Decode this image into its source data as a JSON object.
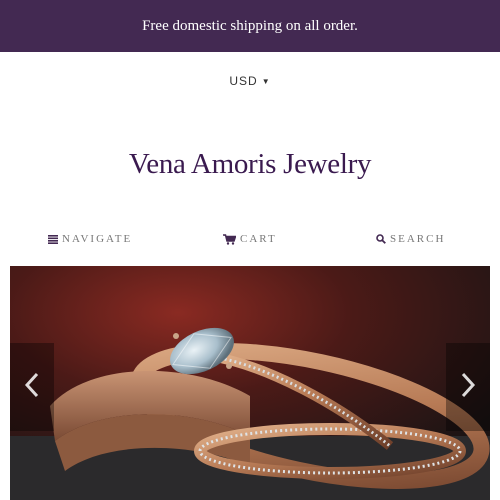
{
  "announcement": {
    "text": "Free domestic shipping on all order."
  },
  "currency": {
    "selected": "USD",
    "icon": "chevron-down-icon"
  },
  "store": {
    "name": "Vena Amoris Jewelry"
  },
  "nav": {
    "navigate_label": "Navigate",
    "cart_label": "Cart",
    "search_label": "Search",
    "navigate_icon": "hamburger-menu-icon",
    "cart_icon": "shopping-cart-icon",
    "search_icon": "search-icon"
  },
  "colors": {
    "brand": "#432952",
    "logo": "#3a1a4f"
  },
  "slideshow": {
    "prev_icon": "chevron-left-icon",
    "next_icon": "chevron-right-icon"
  }
}
